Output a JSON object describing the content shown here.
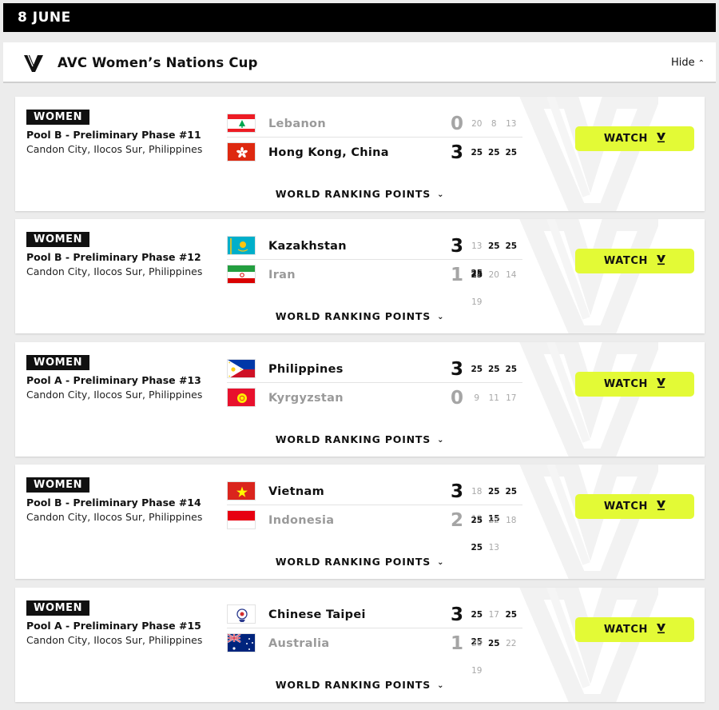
{
  "date_label": "8 JUNE",
  "competition": {
    "title": "AVC Women’s Nations Cup",
    "hide_label": "Hide"
  },
  "watch_label": "WATCH",
  "wrp_label": "WORLD RANKING POINTS",
  "colors": {
    "accent": "#e3fa36",
    "dark": "#000000",
    "muted": "#9a9a9a"
  },
  "matches": [
    {
      "badge": "WOMEN",
      "pool": "Pool B - Preliminary Phase #11",
      "venue": "Candon City, Ilocos Sur, Philippines",
      "teams": [
        {
          "name": "Lebanon",
          "flag": "lebanon-flag",
          "sets": "0",
          "points": [
            "20",
            "8",
            "13"
          ],
          "won": [
            false,
            false,
            false
          ],
          "winner": false
        },
        {
          "name": "Hong Kong, China",
          "flag": "hong-kong-flag",
          "sets": "3",
          "points": [
            "25",
            "25",
            "25"
          ],
          "won": [
            true,
            true,
            true
          ],
          "winner": true
        }
      ]
    },
    {
      "badge": "WOMEN",
      "pool": "Pool B - Preliminary Phase #12",
      "venue": "Candon City, Ilocos Sur, Philippines",
      "teams": [
        {
          "name": "Kazakhstan",
          "flag": "kazakhstan-flag",
          "sets": "3",
          "points": [
            "13",
            "25",
            "25",
            "25"
          ],
          "won": [
            false,
            true,
            true,
            true
          ],
          "winner": true
        },
        {
          "name": "Iran",
          "flag": "iran-flag",
          "sets": "1",
          "points": [
            "25",
            "20",
            "14",
            "19"
          ],
          "won": [
            true,
            false,
            false,
            false
          ],
          "winner": false
        }
      ]
    },
    {
      "badge": "WOMEN",
      "pool": "Pool A - Preliminary Phase #13",
      "venue": "Candon City, Ilocos Sur, Philippines",
      "teams": [
        {
          "name": "Philippines",
          "flag": "philippines-flag",
          "sets": "3",
          "points": [
            "25",
            "25",
            "25"
          ],
          "won": [
            true,
            true,
            true
          ],
          "winner": true
        },
        {
          "name": "Kyrgyzstan",
          "flag": "kyrgyzstan-flag",
          "sets": "0",
          "points": [
            "9",
            "11",
            "17"
          ],
          "won": [
            false,
            false,
            false
          ],
          "winner": false
        }
      ]
    },
    {
      "badge": "WOMEN",
      "pool": "Pool B - Preliminary Phase #14",
      "venue": "Candon City, Ilocos Sur, Philippines",
      "teams": [
        {
          "name": "Vietnam",
          "flag": "vietnam-flag",
          "sets": "3",
          "points": [
            "18",
            "25",
            "25",
            "19",
            "15"
          ],
          "won": [
            false,
            true,
            true,
            false,
            true
          ],
          "winner": true
        },
        {
          "name": "Indonesia",
          "flag": "indonesia-flag",
          "sets": "2",
          "points": [
            "25",
            "22",
            "18",
            "25",
            "13"
          ],
          "won": [
            true,
            false,
            false,
            true,
            false
          ],
          "winner": false
        }
      ]
    },
    {
      "badge": "WOMEN",
      "pool": "Pool A - Preliminary Phase #15",
      "venue": "Candon City, Ilocos Sur, Philippines",
      "teams": [
        {
          "name": "Chinese Taipei",
          "flag": "chinese-taipei-flag",
          "sets": "3",
          "points": [
            "25",
            "17",
            "25",
            "25"
          ],
          "won": [
            true,
            false,
            true,
            true
          ],
          "winner": true
        },
        {
          "name": "Australia",
          "flag": "australia-flag",
          "sets": "1",
          "points": [
            "20",
            "25",
            "22",
            "19"
          ],
          "won": [
            false,
            true,
            false,
            false
          ],
          "winner": false
        }
      ]
    }
  ]
}
